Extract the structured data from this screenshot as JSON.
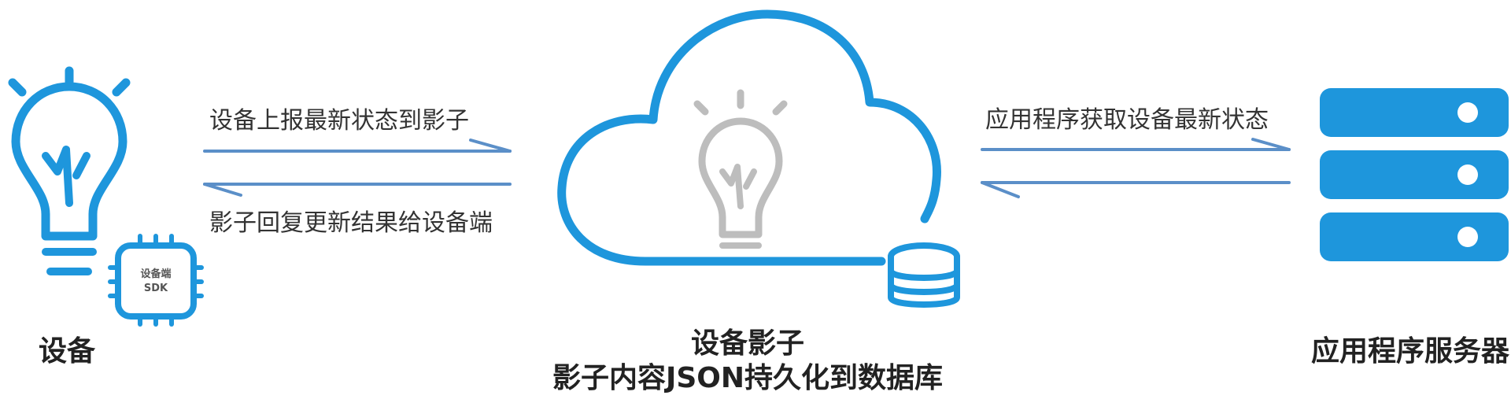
{
  "colors": {
    "primary_blue": "#1E96DC",
    "arrow_blue": "#5B8FC8",
    "bulb_gray": "#BDBDBD",
    "label_text": "#222222",
    "arrow_text": "#333333"
  },
  "nodes": {
    "device": {
      "label": "设备",
      "icon": "lightbulb-icon",
      "chip": {
        "icon": "chip-icon",
        "line1": "设备端",
        "line2": "SDK"
      }
    },
    "shadow": {
      "label": "设备影子",
      "sublabel": "影子内容JSON持久化到数据库",
      "icon": "cloud-icon",
      "inner_icon": "lightbulb-icon",
      "db_icon": "database-icon"
    },
    "server": {
      "label": "应用程序服务器",
      "icon": "server-stack-icon"
    }
  },
  "arrows": {
    "device_to_shadow": "设备上报最新状态到影子",
    "shadow_to_device": "影子回复更新结果给设备端",
    "server_from_shadow": "应用程序获取设备最新状态"
  }
}
